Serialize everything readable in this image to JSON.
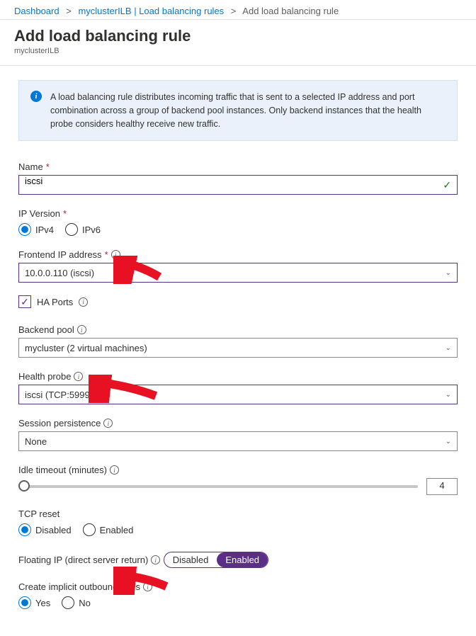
{
  "breadcrumb": {
    "dash": "Dashboard",
    "ilb": "myclusterILB | Load balancing rules",
    "add": "Add load balancing rule"
  },
  "header": {
    "title": "Add load balancing rule",
    "sub": "myclusterILB"
  },
  "info": "A load balancing rule distributes incoming traffic that is sent to a selected IP address and port combination across a group of backend pool instances. Only backend instances that the health probe considers healthy receive new traffic.",
  "name": {
    "label": "Name",
    "value": "iscsi"
  },
  "ipver": {
    "label": "IP Version",
    "v4": "IPv4",
    "v6": "IPv6"
  },
  "frontend": {
    "label": "Frontend IP address",
    "value": "10.0.0.110 (iscsi)"
  },
  "haports": "HA Ports",
  "backend": {
    "label": "Backend pool",
    "value": "mycluster (2 virtual machines)"
  },
  "probe": {
    "label": "Health probe",
    "value": "iscsi (TCP:59998)"
  },
  "session": {
    "label": "Session persistence",
    "value": "None"
  },
  "idle": {
    "label": "Idle timeout (minutes)",
    "value": "4"
  },
  "tcp": {
    "label": "TCP reset",
    "disabled": "Disabled",
    "enabled": "Enabled"
  },
  "floating": {
    "label": "Floating IP (direct server return)",
    "disabled": "Disabled",
    "enabled": "Enabled"
  },
  "outbound": {
    "label": "Create implicit outbound rules",
    "yes": "Yes",
    "no": "No"
  }
}
